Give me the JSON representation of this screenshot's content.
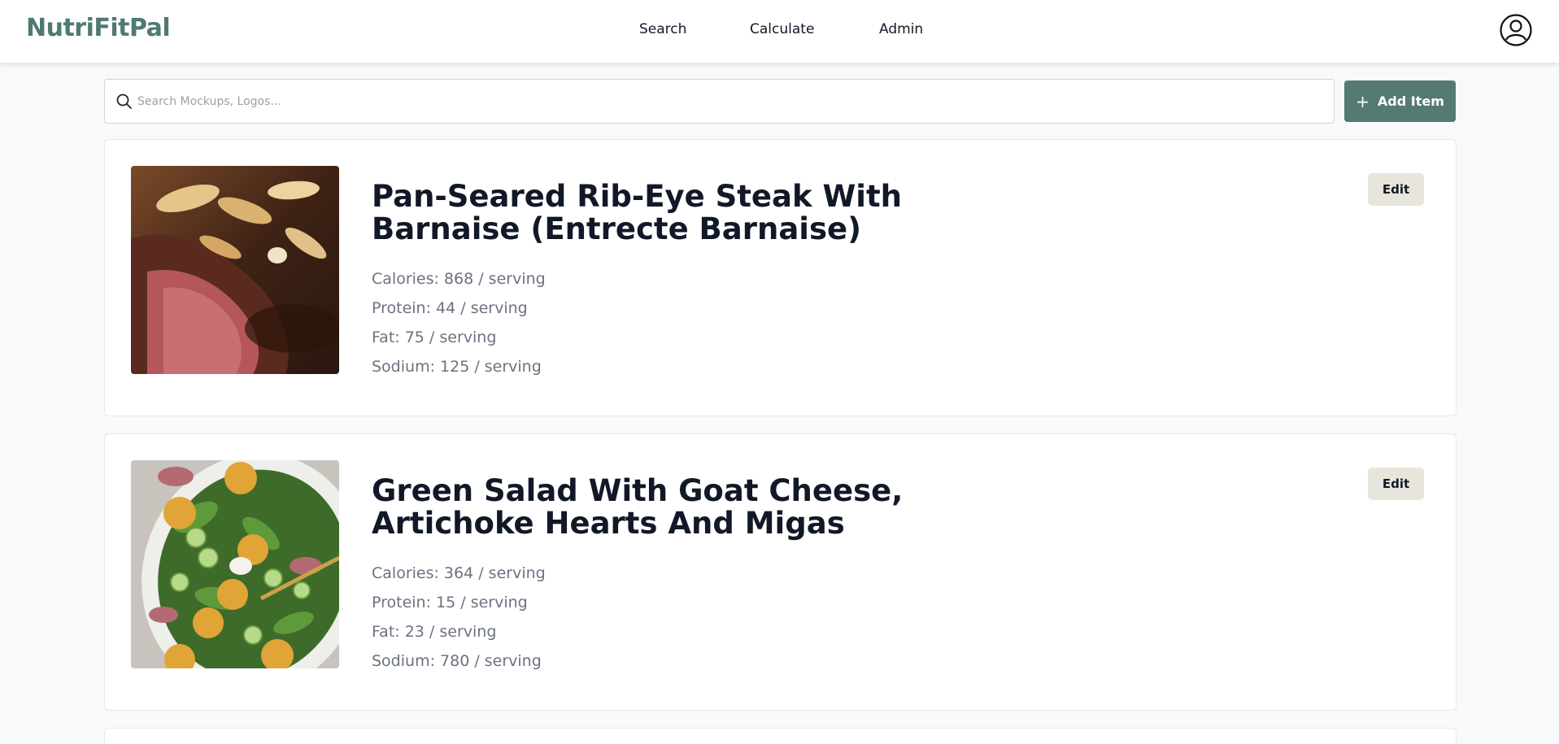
{
  "header": {
    "brand": "NutriFitPal",
    "nav": [
      {
        "label": "Search"
      },
      {
        "label": "Calculate"
      },
      {
        "label": "Admin"
      }
    ],
    "profile_icon": "user-circle-icon"
  },
  "toolbar": {
    "search_placeholder": "Search Mockups, Logos...",
    "search_value": "",
    "add_label": "Add Item",
    "add_icon": "plus-icon"
  },
  "colors": {
    "accent": "#557a71",
    "brand": "#4f7a72",
    "edit_bg": "#e8e6dc"
  },
  "items": [
    {
      "title": "Pan-Seared Rib-Eye Steak With Barnaise (Entrecte Barnaise)",
      "facts": [
        "Calories: 868 / serving",
        "Protein: 44 / serving",
        "Fat: 75 / serving",
        "Sodium: 125 / serving"
      ],
      "edit_label": "Edit"
    },
    {
      "title": "Green Salad With Goat Cheese, Artichoke Hearts And Migas",
      "facts": [
        "Calories: 364 / serving",
        "Protein: 15 / serving",
        "Fat: 23 / serving",
        "Sodium: 780 / serving"
      ],
      "edit_label": "Edit"
    }
  ]
}
